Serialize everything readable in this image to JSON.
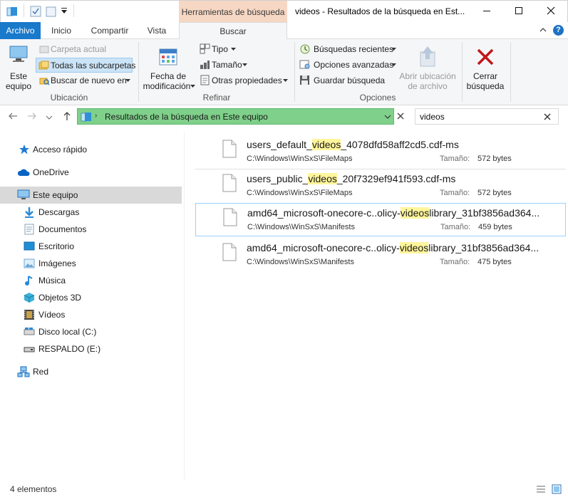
{
  "titlebar": {
    "context_tab": "Herramientas de búsqueda",
    "title": "videos - Resultados de la búsqueda en Est...",
    "qa_icons": [
      "folder-icon",
      "properties-icon",
      "new-folder-icon",
      "dropdown-icon"
    ]
  },
  "tabs": [
    "Archivo",
    "Inicio",
    "Compartir",
    "Vista",
    "Buscar"
  ],
  "ribbon": {
    "ubicacion": {
      "este_equipo": [
        "Este",
        "equipo"
      ],
      "carpeta_actual": "Carpeta actual",
      "todas_subcarpetas": "Todas las subcarpetas",
      "buscar_de_nuevo": "Buscar de nuevo en",
      "label": "Ubicación"
    },
    "refinar": {
      "fecha": [
        "Fecha de",
        "modificación"
      ],
      "tipo": "Tipo",
      "tamano": "Tamaño",
      "otras": "Otras propiedades",
      "label": "Refinar"
    },
    "opciones": {
      "recientes": "Búsquedas recientes",
      "avanzadas": "Opciones avanzadas",
      "guardar": "Guardar búsqueda",
      "abrir_ubicacion": [
        "Abrir ubicación",
        "de archivo"
      ],
      "cerrar": [
        "Cerrar",
        "búsqueda"
      ],
      "label": "Opciones"
    }
  },
  "address": {
    "path": "Resultados de la búsqueda en Este equipo",
    "search_value": "videos"
  },
  "nav": [
    {
      "label": "Acceso rápido",
      "icon": "star-icon",
      "color": "#1e7bd6"
    },
    {
      "label": "OneDrive",
      "icon": "cloud-icon",
      "color": "#0a64c4"
    },
    {
      "label": "Este equipo",
      "icon": "computer-icon",
      "color": "#2a8ad8"
    },
    {
      "label": "Descargas",
      "icon": "download-icon",
      "color": "#2a8ad8"
    },
    {
      "label": "Documentos",
      "icon": "documents-icon",
      "color": "#8aa0b4"
    },
    {
      "label": "Escritorio",
      "icon": "desktop-icon",
      "color": "#1e8fd6"
    },
    {
      "label": "Imágenes",
      "icon": "pictures-icon",
      "color": "#6fa7d4"
    },
    {
      "label": "Música",
      "icon": "music-icon",
      "color": "#2a8ad8"
    },
    {
      "label": "Objetos 3D",
      "icon": "cube-icon",
      "color": "#3bb0d8"
    },
    {
      "label": "Vídeos",
      "icon": "video-icon",
      "color": "#555555"
    },
    {
      "label": "Disco local (C:)",
      "icon": "drive-icon",
      "color": "#777777"
    },
    {
      "label": "RESPALDO (E:)",
      "icon": "usb-drive-icon",
      "color": "#444444"
    },
    {
      "label": "Red",
      "icon": "network-icon",
      "color": "#1e6fc0"
    }
  ],
  "results": [
    {
      "pre": "users_default_",
      "hl": "videos",
      "post": "_4078dfd58aff2cd5.cdf-ms",
      "path": "C:\\Windows\\WinSxS\\FileMaps",
      "size_label": "Tamaño:",
      "size": "572 bytes"
    },
    {
      "pre": "users_public_",
      "hl": "videos",
      "post": "_20f7329ef941f593.cdf-ms",
      "path": "C:\\Windows\\WinSxS\\FileMaps",
      "size_label": "Tamaño:",
      "size": "572 bytes"
    },
    {
      "pre": "amd64_microsoft-onecore-c..olicy-",
      "hl": "videos",
      "post": "library_31bf3856ad364...",
      "path": "C:\\Windows\\WinSxS\\Manifests",
      "size_label": "Tamaño:",
      "size": "459 bytes"
    },
    {
      "pre": "amd64_microsoft-onecore-c..olicy-",
      "hl": "videos",
      "post": "library_31bf3856ad364...",
      "path": "C:\\Windows\\WinSxS\\Manifests",
      "size_label": "Tamaño:",
      "size": "475 bytes"
    }
  ],
  "status": "4 elementos",
  "colors": {
    "accent": "#1979ca",
    "address_highlight": "#7fd08a",
    "match_highlight": "#fff59b",
    "context_tab": "#f6d7c3"
  }
}
